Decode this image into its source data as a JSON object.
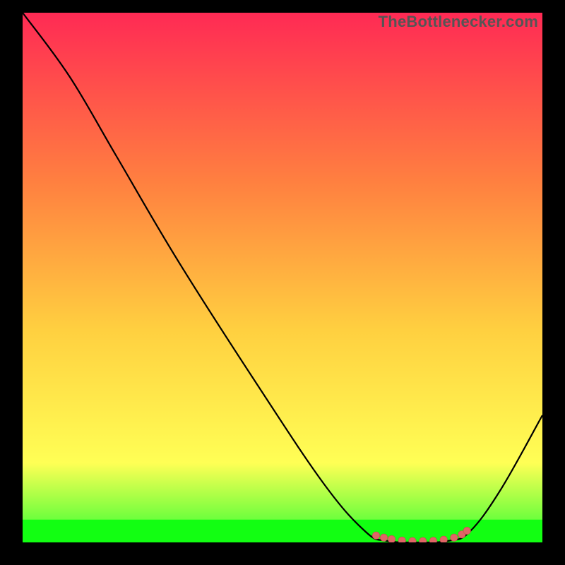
{
  "watermark": "TheBottlenecker.com",
  "chart_data": {
    "type": "line",
    "title": "",
    "xlabel": "",
    "ylabel": "",
    "xlim": [
      0,
      100
    ],
    "ylim": [
      0,
      100
    ],
    "grid": false,
    "background_gradient": [
      "#ff2a54",
      "#ff8040",
      "#ffd040",
      "#ffff55",
      "#33ff33"
    ],
    "curve": [
      {
        "x": 0,
        "y": 100
      },
      {
        "x": 9,
        "y": 88
      },
      {
        "x": 18,
        "y": 73
      },
      {
        "x": 30,
        "y": 53
      },
      {
        "x": 45,
        "y": 30
      },
      {
        "x": 58,
        "y": 11
      },
      {
        "x": 66,
        "y": 2
      },
      {
        "x": 70,
        "y": 0.3
      },
      {
        "x": 76,
        "y": 0
      },
      {
        "x": 82,
        "y": 0.3
      },
      {
        "x": 86,
        "y": 2
      },
      {
        "x": 92,
        "y": 10
      },
      {
        "x": 100,
        "y": 24
      }
    ],
    "markers": [
      {
        "x": 68,
        "y": 1.3
      },
      {
        "x": 69.5,
        "y": 0.9
      },
      {
        "x": 71,
        "y": 0.6
      },
      {
        "x": 73,
        "y": 0.35
      },
      {
        "x": 75,
        "y": 0.25
      },
      {
        "x": 77,
        "y": 0.25
      },
      {
        "x": 79,
        "y": 0.3
      },
      {
        "x": 81,
        "y": 0.5
      },
      {
        "x": 83,
        "y": 0.9
      },
      {
        "x": 84.5,
        "y": 1.5
      },
      {
        "x": 85.5,
        "y": 2.2
      }
    ],
    "green_band_height_pct": 4.3
  }
}
